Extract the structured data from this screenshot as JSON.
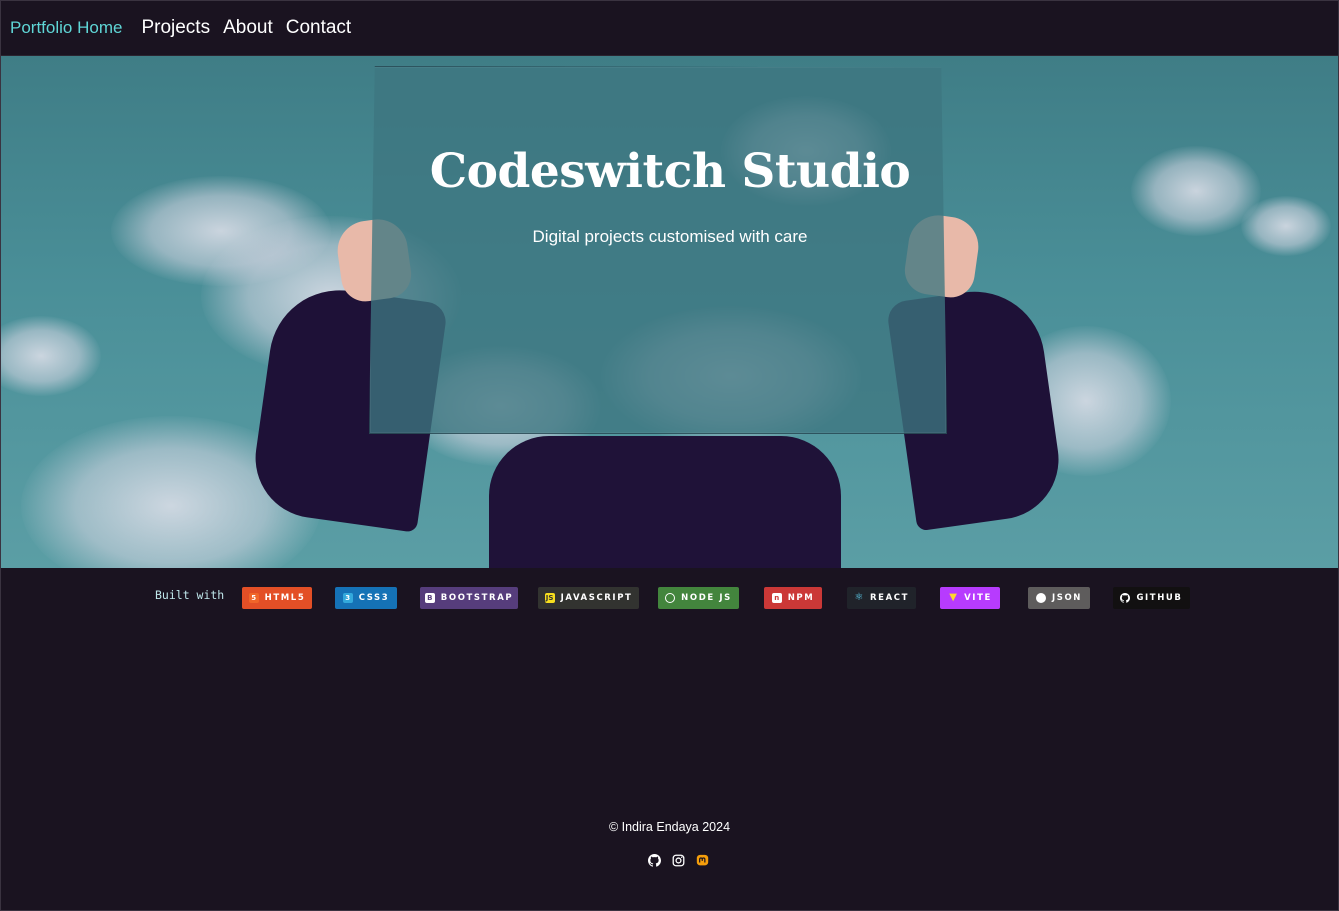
{
  "nav": {
    "brand": "Portfolio Home",
    "links": [
      "Projects",
      "About",
      "Contact"
    ]
  },
  "hero": {
    "title": "Codeswitch Studio",
    "subtitle": "Digital projects customised with care"
  },
  "built_with": {
    "label": "Built with",
    "badges": [
      {
        "label": "HTML5",
        "icon": "html5-icon",
        "color": "#e34f26"
      },
      {
        "label": "CSS3",
        "icon": "css3-icon",
        "color": "#1572b6"
      },
      {
        "label": "BOOTSTRAP",
        "icon": "bootstrap-icon",
        "color": "#563d7c"
      },
      {
        "label": "JAVASCRIPT",
        "icon": "javascript-icon",
        "color": "#323330"
      },
      {
        "label": "NODE JS",
        "icon": "nodejs-icon",
        "color": "#43853d"
      },
      {
        "label": "NPM",
        "icon": "npm-icon",
        "color": "#cb3837"
      },
      {
        "label": "REACT",
        "icon": "react-icon",
        "color": "#20232a"
      },
      {
        "label": "VITE",
        "icon": "vite-icon",
        "color": "#b73bfe"
      },
      {
        "label": "JSON",
        "icon": "json-icon",
        "color": "#5e5c5c"
      },
      {
        "label": "GITHUB",
        "icon": "github-icon",
        "color": "#121011"
      }
    ]
  },
  "footer": {
    "copyright": "© Indira Endaya 2024",
    "social": [
      "github-icon",
      "instagram-icon",
      "mastodon-icon"
    ]
  },
  "colors": {
    "background": "#1a1320",
    "accent": "#5fd6d6"
  }
}
